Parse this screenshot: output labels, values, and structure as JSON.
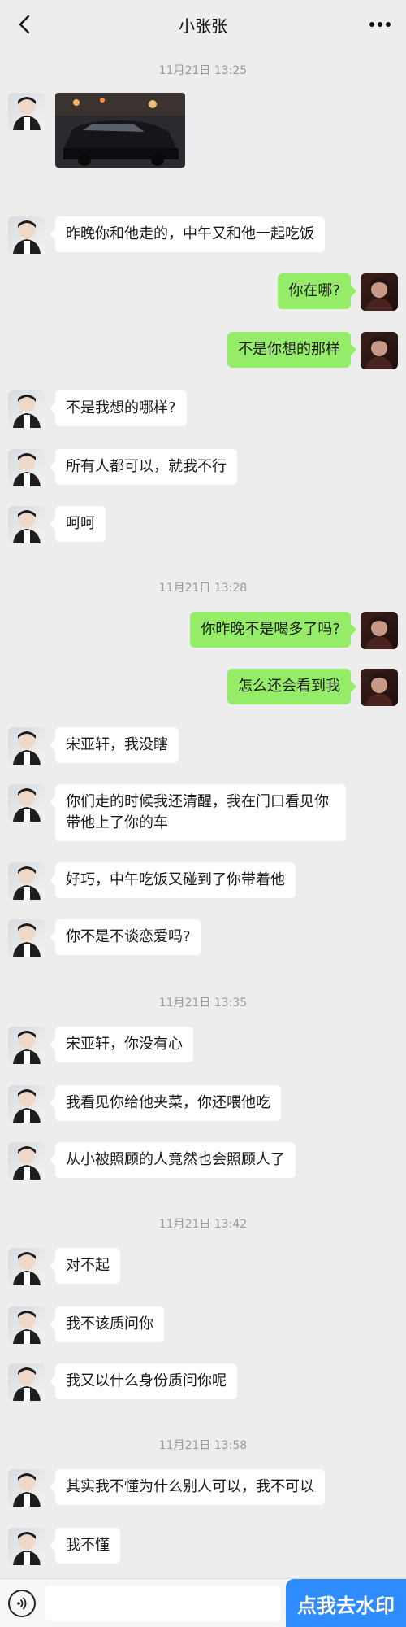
{
  "header": {
    "title": "小张张"
  },
  "icons": {
    "back": "chevron-left-icon",
    "more": "more-dots-icon",
    "voice": "voice-icon"
  },
  "colors": {
    "self_bubble": "#95ec69",
    "peer_bubble": "#ffffff",
    "background": "#ededed",
    "action_blue": "#2f8cff"
  },
  "messages": {
    "t1": "11月21日 13:25",
    "m2": "昨晚你和他走的，中午又和他一起吃饭",
    "m3": "你在哪?",
    "m4": "不是你想的那样",
    "m5": "不是我想的哪样?",
    "m6": "所有人都可以，就我不行",
    "m7": "呵呵",
    "t2": "11月21日 13:28",
    "m8": "你昨晚不是喝多了吗?",
    "m9": "怎么还会看到我",
    "m10": "宋亚轩，我没瞎",
    "m11": "你们走的时候我还清醒，我在门口看见你带他上了你的车",
    "m12": "好巧，中午吃饭又碰到了你带着他",
    "m13": "你不是不谈恋爱吗?",
    "t3": "11月21日 13:35",
    "m14": "宋亚轩，你没有心",
    "m15": "我看见你给他夹菜，你还喂他吃",
    "m16": "从小被照顾的人竟然也会照顾人了",
    "t4": "11月21日 13:42",
    "m17": "对不起",
    "m18": "我不该质问你",
    "m19": "我又以什么身份质问你呢",
    "t5": "11月21日 13:58",
    "m20": "其实我不懂为什么别人可以，我不可以",
    "m21": "我不懂"
  },
  "bottom": {
    "watermark_button": "点我去水印"
  }
}
